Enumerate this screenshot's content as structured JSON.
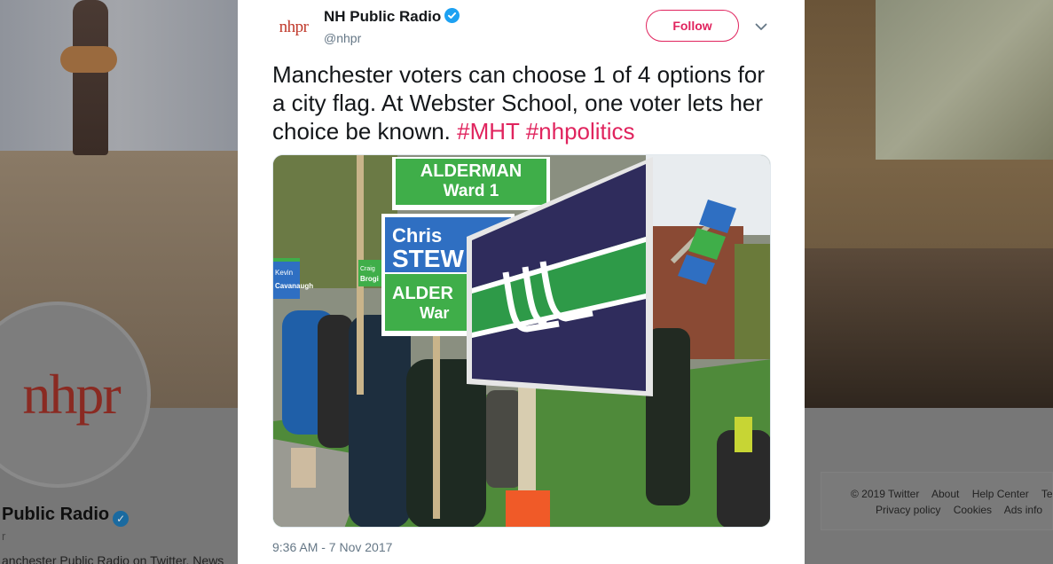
{
  "background": {
    "avatar_text": "nhpr",
    "profile_name": "Public Radio",
    "profile_handle": "r",
    "profile_bio": "anchester Public Radio on Twitter. News",
    "footer": {
      "row1": [
        "© 2019 Twitter",
        "About",
        "Help Center",
        "Term"
      ],
      "row2": [
        "Privacy policy",
        "Cookies",
        "Ads info"
      ]
    }
  },
  "tweet": {
    "avatar_text": "nhpr",
    "author_name": "NH Public Radio",
    "author_handle": "@nhpr",
    "follow_label": "Follow",
    "text_plain": "Manchester voters can choose 1 of 4 options for a city flag. At Webster School, one voter lets her choice be known. ",
    "hashtags": [
      "#MHT",
      "#nhpolitics"
    ],
    "timestamp": "9:36 AM - 7 Nov 2017",
    "media_signs": {
      "sign1_line1": "ALDERMAN",
      "sign1_line2": "Ward 1",
      "sign2_line1": "Chris",
      "sign2_line2": "STEW",
      "sign2_line3": "ALDER",
      "sign2_line4": "War",
      "sign3_line1": "Kevin",
      "sign3_line2": "Cavanaugh",
      "sign4_line1": "Craig",
      "sign4_line2": "Brogi"
    }
  },
  "colors": {
    "brand": "#c0392b",
    "accent": "#e0245e",
    "verified": "#1da1f2",
    "flag_navy": "#2f2c5c",
    "flag_green": "#2e9a48"
  }
}
